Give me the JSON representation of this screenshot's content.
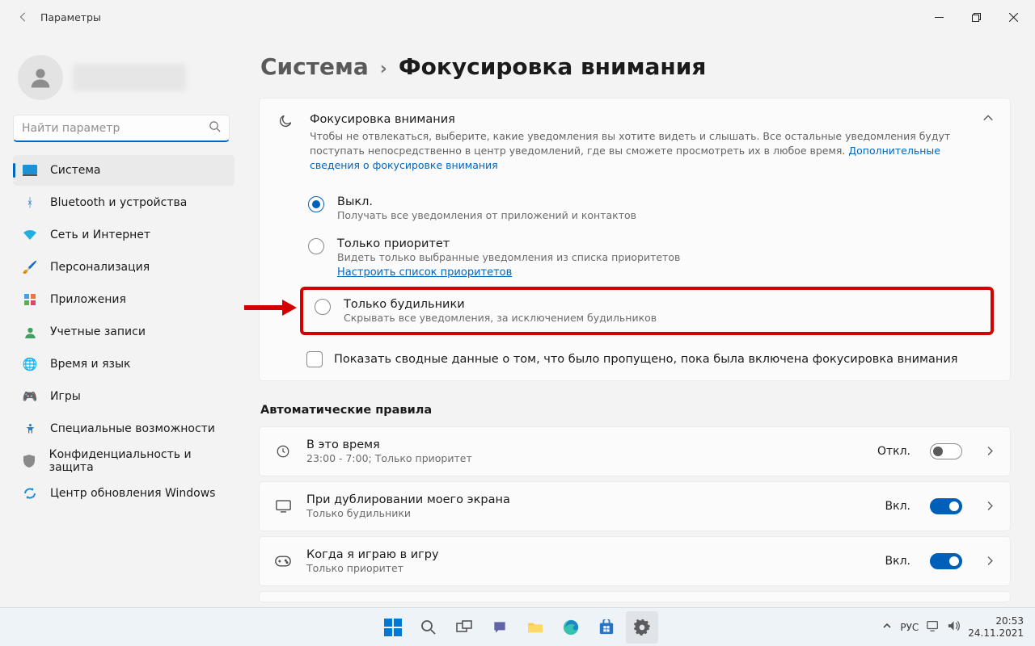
{
  "window": {
    "app_title": "Параметры"
  },
  "search": {
    "placeholder": "Найти параметр"
  },
  "nav": {
    "items": [
      {
        "label": "Система"
      },
      {
        "label": "Bluetooth и устройства"
      },
      {
        "label": "Сеть и Интернет"
      },
      {
        "label": "Персонализация"
      },
      {
        "label": "Приложения"
      },
      {
        "label": "Учетные записи"
      },
      {
        "label": "Время и язык"
      },
      {
        "label": "Игры"
      },
      {
        "label": "Специальные возможности"
      },
      {
        "label": "Конфиденциальность и защита"
      },
      {
        "label": "Центр обновления Windows"
      }
    ]
  },
  "breadcrumb": {
    "parent": "Система",
    "current": "Фокусировка внимания"
  },
  "focus": {
    "title": "Фокусировка внимания",
    "desc": "Чтобы не отвлекаться, выберите, какие уведомления вы хотите видеть и слышать. Все остальные уведомления будут поступать непосредственно в центр уведомлений, где вы сможете просмотреть их в любое время.  ",
    "learn_more": "Дополнительные сведения о фокусировке внимания",
    "options": [
      {
        "title": "Выкл.",
        "sub": "Получать все уведомления от приложений и контактов"
      },
      {
        "title": "Только приоритет",
        "sub": "Видеть только выбранные уведомления из списка приоритетов",
        "link": "Настроить список приоритетов"
      },
      {
        "title": "Только будильники",
        "sub": "Скрывать все уведомления, за исключением будильников"
      }
    ],
    "summary_check": "Показать сводные данные о том, что было пропущено, пока была включена фокусировка внимания"
  },
  "rules": {
    "heading": "Автоматические правила",
    "items": [
      {
        "title": "В это время",
        "sub": "23:00 - 7:00; Только приоритет",
        "state": "Откл.",
        "on": false
      },
      {
        "title": "При дублировании моего экрана",
        "sub": "Только будильники",
        "state": "Вкл.",
        "on": true
      },
      {
        "title": "Когда я играю в игру",
        "sub": "Только приоритет",
        "state": "Вкл.",
        "on": true
      }
    ]
  },
  "taskbar": {
    "lang": "РУС",
    "time": "20:53",
    "date": "24.11.2021"
  }
}
